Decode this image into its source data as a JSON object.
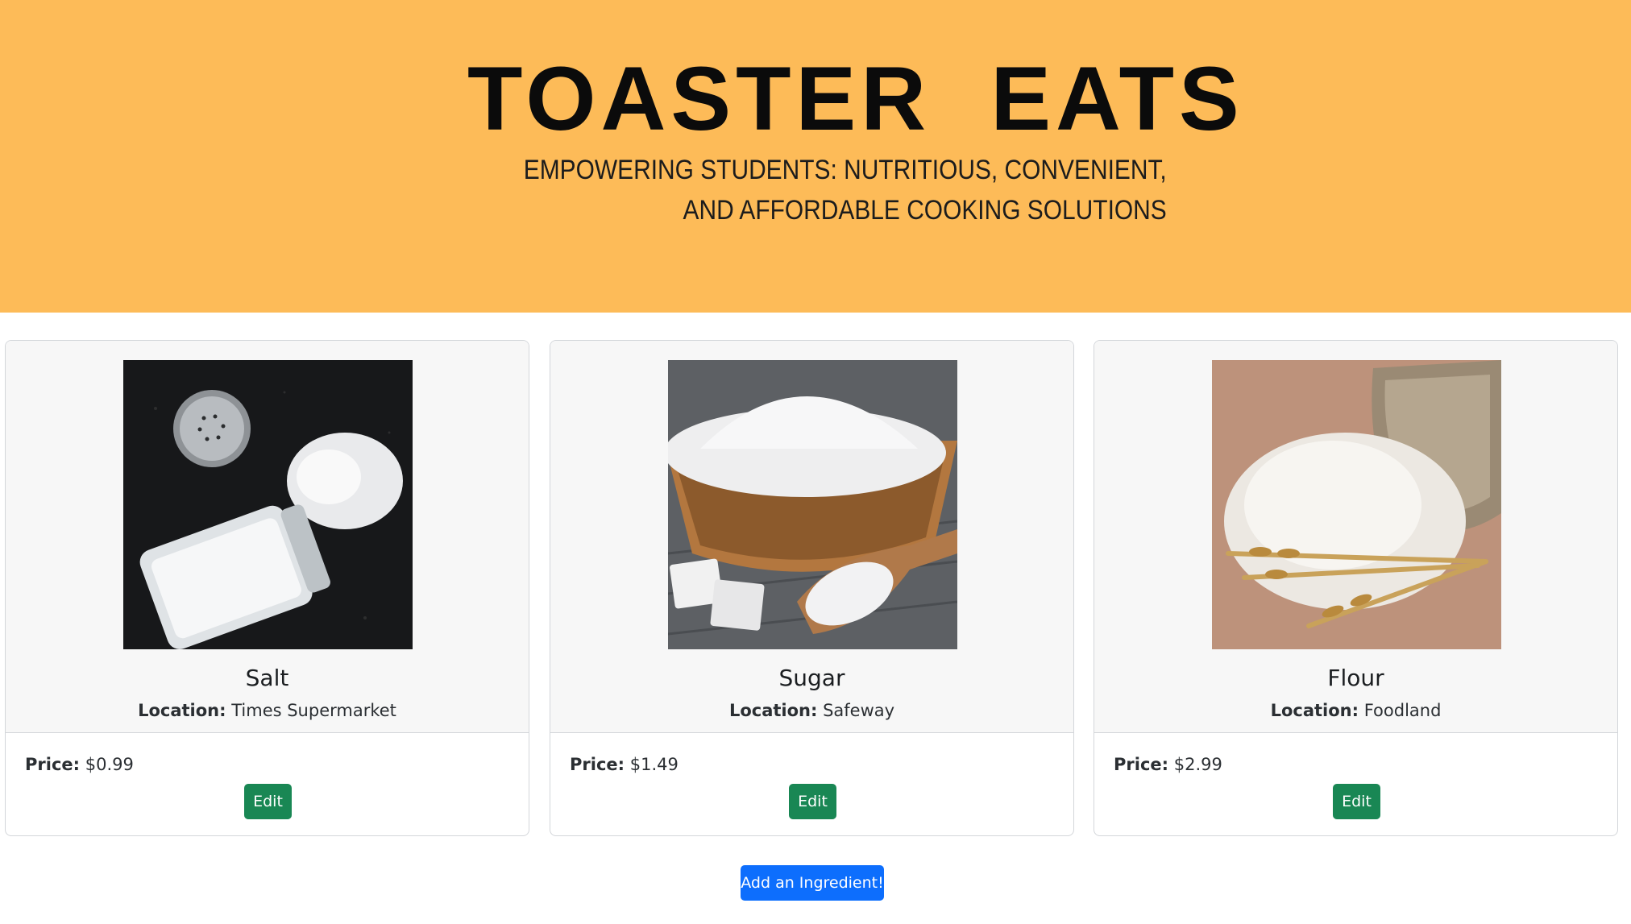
{
  "header": {
    "brand": "TOASTER  EATS",
    "tagline_line1": "EMPOWERING STUDENTS: NUTRITIOUS, CONVENIENT,",
    "tagline_line2": "AND AFFORDABLE COOKING SOLUTIONS"
  },
  "ingredients": [
    {
      "name": "Salt",
      "location_label": "Location:",
      "location": "Times Supermarket",
      "price_label": "Price:",
      "price": "$0.99",
      "edit_label": "Edit"
    },
    {
      "name": "Sugar",
      "location_label": "Location:",
      "location": "Safeway",
      "price_label": "Price:",
      "price": "$1.49",
      "edit_label": "Edit"
    },
    {
      "name": "Flour",
      "location_label": "Location:",
      "location": "Foodland",
      "price_label": "Price:",
      "price": "$2.99",
      "edit_label": "Edit"
    }
  ],
  "actions": {
    "add_label": "Add an Ingredient!"
  },
  "colors": {
    "hero": "#fdbb58",
    "edit_button": "#198754",
    "add_button": "#0d6efd"
  }
}
